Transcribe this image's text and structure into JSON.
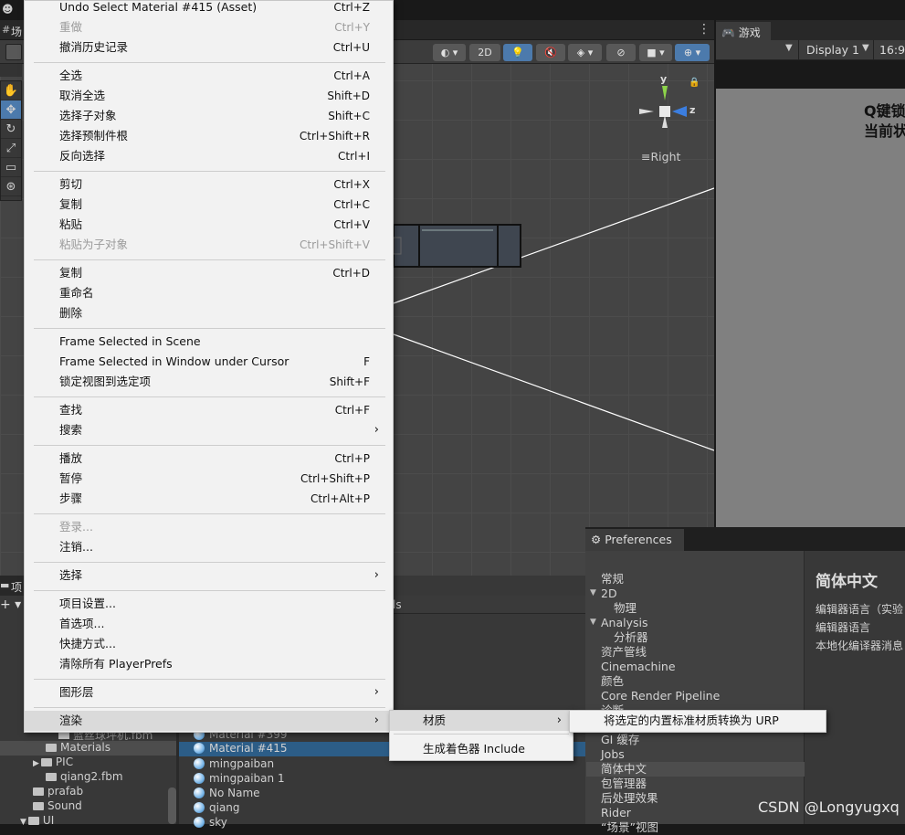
{
  "top_tabs": {
    "scene_label": "场",
    "project_label": "项",
    "scene_right_label": "2D"
  },
  "game": {
    "tab_label": "游戏",
    "display": "Display 1",
    "aspect": "16:9",
    "line1": "Q键锁",
    "line2": "当前状"
  },
  "gizmo": {
    "y_label": "y",
    "z_label": "z",
    "view_label": "Right"
  },
  "project_tree": [
    {
      "label": "Materials",
      "indent": 1
    },
    {
      "label": "PIC",
      "indent": 1
    },
    {
      "label": "qiang2.fbm",
      "indent": 1
    },
    {
      "label": "prafab",
      "indent": 0
    },
    {
      "label": "Sound",
      "indent": 0
    },
    {
      "label": "UI",
      "indent": 0
    }
  ],
  "project_tree_partial": "蓝丝球坪机.fbm",
  "assets": [
    {
      "label": "Material #399"
    },
    {
      "label": "Material #415",
      "selected": true
    },
    {
      "label": "mingpaiban"
    },
    {
      "label": "mingpaiban 1"
    },
    {
      "label": "No Name"
    },
    {
      "label": "qiang"
    },
    {
      "label": "sky"
    }
  ],
  "assets_header_partial": "ls",
  "context_menu": {
    "items": [
      {
        "label": "Undo Select Material #415 (Asset)",
        "shortcut": "Ctrl+Z"
      },
      {
        "label": "重做",
        "shortcut": "Ctrl+Y",
        "disabled": true
      },
      {
        "label": "撤消历史记录",
        "shortcut": "Ctrl+U"
      },
      {
        "label": "全选",
        "shortcut": "Ctrl+A"
      },
      {
        "label": "取消全选",
        "shortcut": "Shift+D"
      },
      {
        "label": "选择子对象",
        "shortcut": "Shift+C"
      },
      {
        "label": "选择预制件根",
        "shortcut": "Ctrl+Shift+R"
      },
      {
        "label": "反向选择",
        "shortcut": "Ctrl+I"
      },
      {
        "label": "剪切",
        "shortcut": "Ctrl+X"
      },
      {
        "label": "复制",
        "shortcut": "Ctrl+C"
      },
      {
        "label": "粘贴",
        "shortcut": "Ctrl+V"
      },
      {
        "label": "粘贴为子对象",
        "shortcut": "Ctrl+Shift+V",
        "disabled": true
      },
      {
        "label": "复制",
        "shortcut": "Ctrl+D"
      },
      {
        "label": "重命名",
        "shortcut": ""
      },
      {
        "label": "删除",
        "shortcut": ""
      },
      {
        "label": "Frame Selected in Scene",
        "shortcut": ""
      },
      {
        "label": "Frame Selected in Window under Cursor",
        "shortcut": "F"
      },
      {
        "label": "锁定视图到选定项",
        "shortcut": "Shift+F"
      },
      {
        "label": "查找",
        "shortcut": "Ctrl+F"
      },
      {
        "label": "搜索",
        "shortcut": "",
        "submenu": true
      },
      {
        "label": "播放",
        "shortcut": "Ctrl+P"
      },
      {
        "label": "暂停",
        "shortcut": "Ctrl+Shift+P"
      },
      {
        "label": "步骤",
        "shortcut": "Ctrl+Alt+P"
      },
      {
        "label": "登录...",
        "shortcut": "",
        "disabled": true
      },
      {
        "label": "注销...",
        "shortcut": ""
      },
      {
        "label": "选择",
        "shortcut": "",
        "submenu": true
      },
      {
        "label": "项目设置...",
        "shortcut": ""
      },
      {
        "label": "首选项...",
        "shortcut": ""
      },
      {
        "label": "快捷方式...",
        "shortcut": ""
      },
      {
        "label": "清除所有 PlayerPrefs",
        "shortcut": ""
      },
      {
        "label": "图形层",
        "shortcut": "",
        "submenu": true
      },
      {
        "label": "渲染",
        "shortcut": "",
        "submenu": true,
        "highlighted": true
      }
    ]
  },
  "submenu_render": {
    "items": [
      {
        "label": "材质",
        "submenu": true,
        "highlighted": true
      },
      {
        "label": "生成着色器 Include"
      }
    ]
  },
  "submenu_material": {
    "items": [
      {
        "label": "将选定的内置标准材质转换为 URP"
      }
    ]
  },
  "preferences": {
    "tab_label": "Preferences",
    "items": [
      {
        "label": "常规",
        "level": 0
      },
      {
        "label": "2D",
        "level": 0,
        "expanded": true
      },
      {
        "label": "物理",
        "level": 1
      },
      {
        "label": "Analysis",
        "level": 0,
        "expanded": true
      },
      {
        "label": "分析器",
        "level": 1
      },
      {
        "label": "资产管线",
        "level": 0
      },
      {
        "label": "Cinemachine",
        "level": 0
      },
      {
        "label": "颜色",
        "level": 0
      },
      {
        "label": "Core Render Pipeline",
        "level": 0
      },
      {
        "label": "诊断",
        "level": 0
      },
      {
        "label": "GI 缓存",
        "level": 0
      },
      {
        "label": "Jobs",
        "level": 0
      },
      {
        "label": "简体中文",
        "level": 0,
        "selected": true
      },
      {
        "label": "包管理器",
        "level": 0
      },
      {
        "label": "后处理效果",
        "level": 0
      },
      {
        "label": "Rider",
        "level": 0
      },
      {
        "label": "“场景”视图",
        "level": 0
      }
    ],
    "title": "简体中文",
    "rows": [
      "编辑器语言（实验",
      "编辑器语言",
      "本地化编译器消息"
    ]
  },
  "watermark": "CSDN @Longyugxq"
}
